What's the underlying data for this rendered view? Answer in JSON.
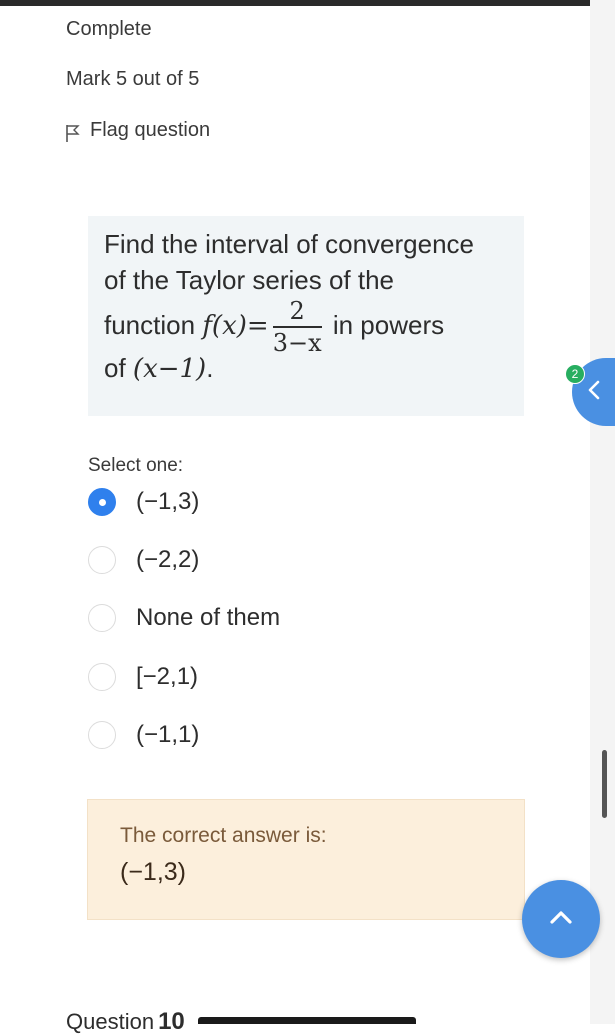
{
  "status": {
    "state": "Complete",
    "mark": "Mark 5 out of 5",
    "flag_label": "Flag question"
  },
  "question": {
    "line1": "Find the interval of convergence",
    "line2": "of the Taylor series of the",
    "line3_prefix": "function",
    "fx": "f(x)",
    "equals": "=",
    "frac_num": "2",
    "frac_den": "3−x",
    "line3_suffix": "in powers",
    "line4_prefix": "of",
    "line4_math": "(x−1)",
    "line4_suffix": "."
  },
  "select_label": "Select one:",
  "options": [
    {
      "label": "(−1,3)",
      "checked": true
    },
    {
      "label": "(−2,2)",
      "checked": false
    },
    {
      "label": "None of them",
      "checked": false
    },
    {
      "label": "[−2,1)",
      "checked": false
    },
    {
      "label": "(−1,1)",
      "checked": false
    }
  ],
  "feedback": {
    "title": "The correct answer is:",
    "answer": "(−1,3)"
  },
  "side_drawer": {
    "badge": "2",
    "icon": "chevron-left-icon"
  },
  "back_to_top_icon": "chevron-up-icon",
  "next_question": {
    "label": "Question",
    "number": "10"
  },
  "colors": {
    "accent": "#4a90e2",
    "radio_checked": "#2f80ed",
    "question_bg": "#f1f5f7",
    "feedback_bg": "#fcefdc",
    "badge": "#27ae60"
  }
}
